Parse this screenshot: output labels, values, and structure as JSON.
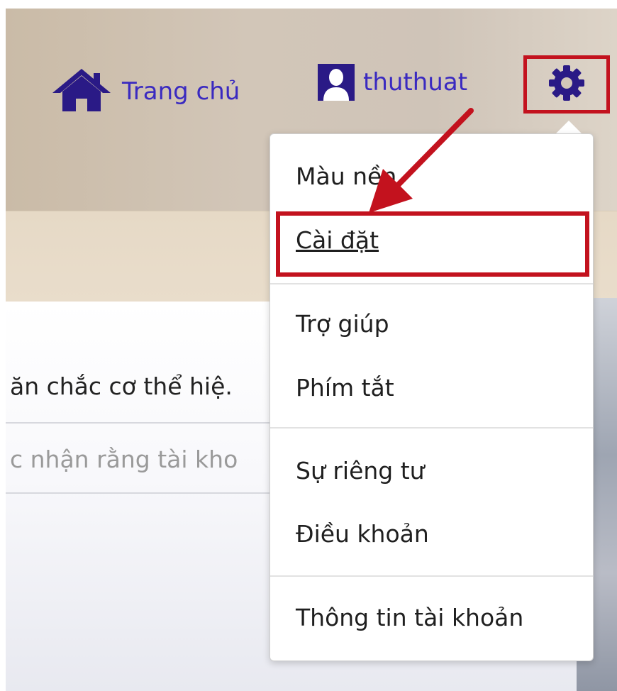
{
  "nav": {
    "home_icon": "home-icon",
    "home_label": "Trang chủ",
    "user_icon": "user-avatar-icon",
    "user_label": "thuthuat",
    "settings_icon": "gear-icon"
  },
  "content": {
    "row1_text": "ăn chắc cơ thể hiệ.",
    "row2_text": "c nhận rằng tài kho"
  },
  "menu": {
    "items": [
      {
        "label": "Màu nền"
      },
      {
        "label": "Cài đặt"
      },
      {
        "label": "Trợ giúp"
      },
      {
        "label": "Phím tắt"
      },
      {
        "label": "Sự riêng tư"
      },
      {
        "label": "Điều khoản"
      },
      {
        "label": "Thông tin tài khoản"
      }
    ]
  },
  "colors": {
    "link": "#3a2ac0",
    "icon": "#2a1a86",
    "annotation": "#c3121e"
  }
}
